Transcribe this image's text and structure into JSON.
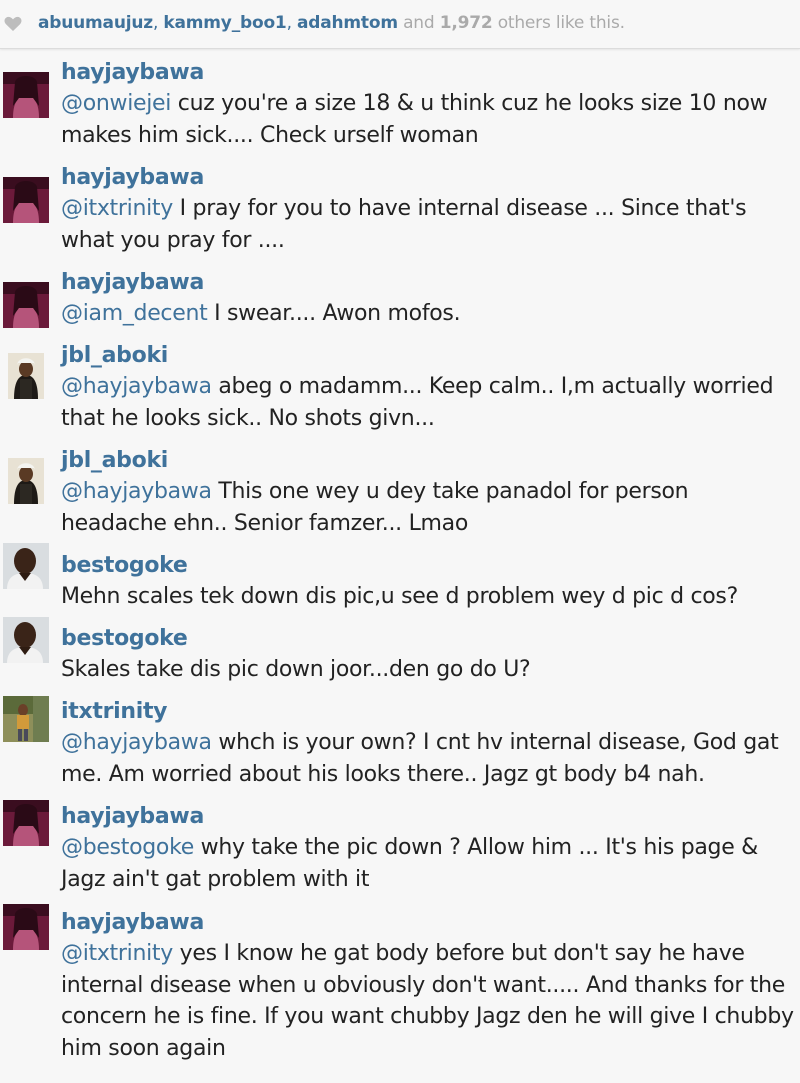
{
  "likes": {
    "likers": [
      "abuumaujuz",
      "kammy_boo1",
      "adahmtom"
    ],
    "separator": ",",
    "and_text": "and",
    "count": "1,972",
    "others_text": "others like this."
  },
  "comments": [
    {
      "username": "hayjaybawa",
      "mention": "@onwiejei",
      "text": " cuz you're a size 18 & u think cuz he looks size 10 now makes him sick.... Check urself woman"
    },
    {
      "username": "hayjaybawa",
      "mention": "@itxtrinity",
      "text": " I pray for you to have internal disease ... Since that's what you pray for ...."
    },
    {
      "username": "hayjaybawa",
      "mention": "@iam_decent",
      "text": " I swear.... Awon mofos."
    },
    {
      "username": "jbl_aboki",
      "mention": "@hayjaybawa",
      "text": " abeg o madamm... Keep calm.. I,m actually worried that he looks sick.. No shots givn..."
    },
    {
      "username": "jbl_aboki",
      "mention": "@hayjaybawa",
      "text": " This one wey u dey take panadol for person headache ehn.. Senior famzer... Lmao"
    },
    {
      "username": "bestogoke",
      "mention": "",
      "text": "Mehn scales tek down dis pic,u see d problem wey d pic d cos?"
    },
    {
      "username": "bestogoke",
      "mention": "",
      "text": "Skales take dis pic down joor...den go do U?"
    },
    {
      "username": "itxtrinity",
      "mention": "@hayjaybawa",
      "text": " whch is your own? I cnt hv internal disease, God gat me. Am worried about his looks there.. Jagz gt body b4 nah."
    },
    {
      "username": "hayjaybawa",
      "mention": "@bestogoke",
      "text": " why take the pic down ? Allow him ... It's his page & Jagz ain't gat problem with it"
    },
    {
      "username": "hayjaybawa",
      "mention": "@itxtrinity",
      "text": " yes I know he gat body before but don't say he have internal disease when u obviously don't want..... And thanks for the concern he is fine. If you want chubby Jagz den he will give I chubby him soon again"
    }
  ],
  "colors": {
    "link": "#3f729b",
    "muted": "#aaaaaa",
    "text": "#222222",
    "background": "#f7f7f7"
  }
}
